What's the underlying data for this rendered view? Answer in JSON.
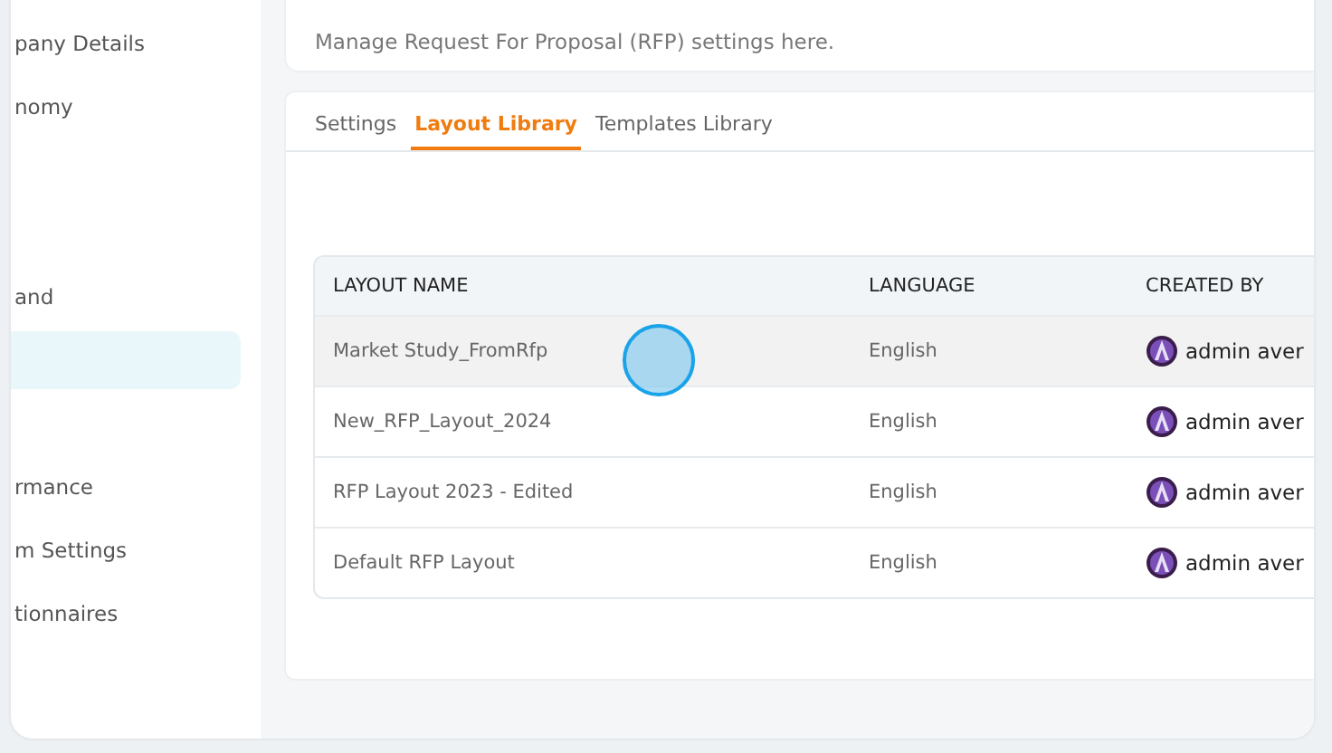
{
  "sidebar": {
    "items": [
      {
        "label": "pany Details",
        "selected": false
      },
      {
        "label": "nomy",
        "selected": false
      },
      {
        "label": "and",
        "selected": false
      },
      {
        "selected": true
      },
      {
        "label": "rmance",
        "selected": false
      },
      {
        "label": "m Settings",
        "selected": false
      },
      {
        "label": "tionnaires",
        "selected": false
      }
    ]
  },
  "header": {
    "description": "Manage Request For Proposal (RFP) settings here."
  },
  "tabs": [
    {
      "label": "Settings",
      "selected": false
    },
    {
      "label": "Layout Library",
      "selected": true
    },
    {
      "label": "Templates Library",
      "selected": false
    }
  ],
  "table": {
    "columns": [
      "LAYOUT NAME",
      "LANGUAGE",
      "CREATED BY"
    ],
    "rows": [
      {
        "name": "Market Study_FromRfp",
        "language": "English",
        "created_by": "admin aver",
        "hovered": true
      },
      {
        "name": "New_RFP_Layout_2024",
        "language": "English",
        "created_by": "admin aver",
        "hovered": false
      },
      {
        "name": "RFP Layout 2023 - Edited",
        "language": "English",
        "created_by": "admin aver",
        "hovered": false
      },
      {
        "name": "Default RFP Layout",
        "language": "English",
        "created_by": "admin aver",
        "hovered": false
      }
    ]
  }
}
